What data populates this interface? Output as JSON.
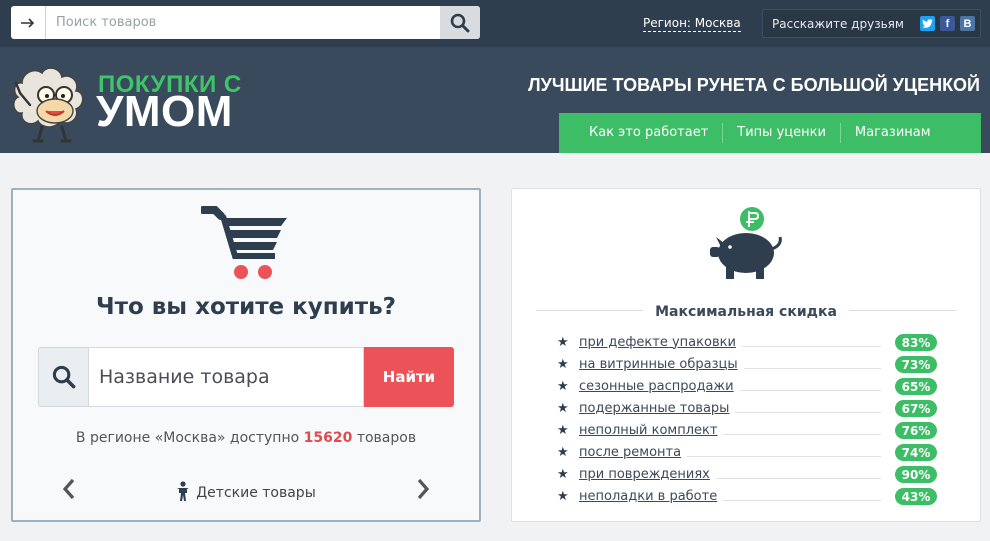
{
  "topbar": {
    "search_placeholder": "Поиск товаров",
    "region_label": "Регион: Москва",
    "share_label": "Расскажите друзьям",
    "social": [
      "twitter-icon",
      "facebook-icon",
      "vk-icon"
    ]
  },
  "header": {
    "logo_line1": "ПОКУПКИ С",
    "logo_line2": "УМОМ",
    "tagline": "ЛУЧШИЕ ТОВАРЫ РУНЕТА С БОЛЬШОЙ УЦЕНКОЙ",
    "nav": [
      {
        "label": "Как это работает"
      },
      {
        "label": "Типы уценки"
      },
      {
        "label": "Магазинам"
      }
    ]
  },
  "left_panel": {
    "question": "Что вы хотите купить?",
    "search_placeholder": "Название товара",
    "search_button": "Найти",
    "avail_prefix": "В регионе «Москва» доступно",
    "avail_count": "15620",
    "avail_suffix": "товаров",
    "category": "Детские товары"
  },
  "right_panel": {
    "title": "Максимальная скидка",
    "discounts": [
      {
        "label": "при дефекте упаковки",
        "pct": "83%"
      },
      {
        "label": "на витринные образцы",
        "pct": "73%"
      },
      {
        "label": "сезонные распродажи",
        "pct": "65%"
      },
      {
        "label": "подержанные товары",
        "pct": "67%"
      },
      {
        "label": "неполный комплект",
        "pct": "76%"
      },
      {
        "label": "после ремонта",
        "pct": "74%"
      },
      {
        "label": "при повреждениях",
        "pct": "90%"
      },
      {
        "label": "неполадки в работе",
        "pct": "43%"
      }
    ]
  },
  "colors": {
    "dark_bar": "#2e3e4f",
    "header_bg": "#384a5c",
    "accent_green": "#3ebd67",
    "accent_red": "#ec5358"
  }
}
